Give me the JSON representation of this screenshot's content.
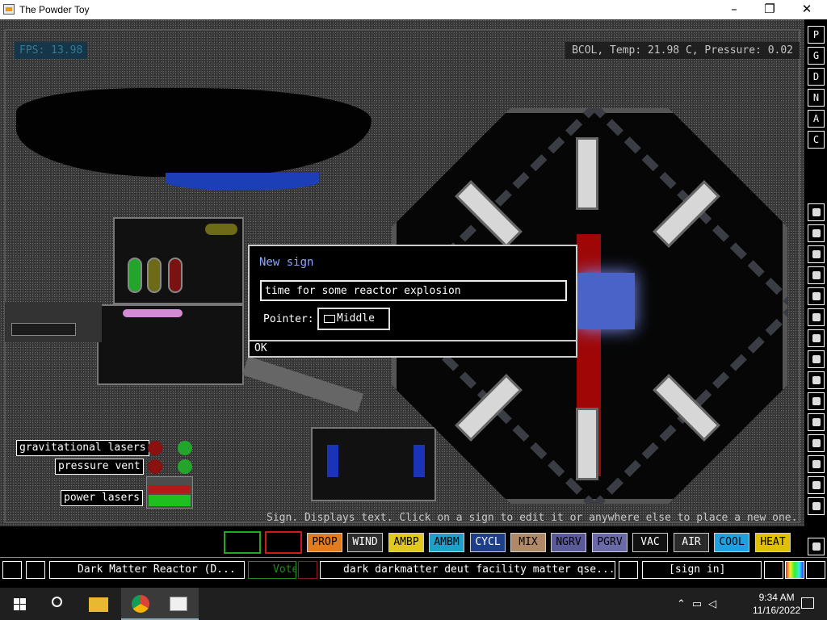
{
  "window": {
    "title": "The Powder Toy",
    "minimize": "–",
    "maximize": "❐",
    "close": "✕"
  },
  "hud": {
    "fps": "FPS: 13.98",
    "info": "BCOL, Temp: 21.98 C, Pressure: 0.02"
  },
  "sim_labels": {
    "label1": "gravitational lasers",
    "label2": "pressure vent",
    "label3": "power lasers"
  },
  "hint": "Sign. Displays text. Click on a sign to edit it or anywhere else to place a new one.",
  "dialog": {
    "title": "New sign",
    "text": "time for some reactor explosion",
    "pointer_label": "Pointer:",
    "pointer_value": "Middle",
    "ok": "OK"
  },
  "right_menu": [
    "P",
    "G",
    "D",
    "N",
    "A",
    "C"
  ],
  "elements": [
    {
      "label": "PROP",
      "bg": "#e07b1f",
      "fg": "#000"
    },
    {
      "label": "WIND",
      "bg": "#2c2c2c",
      "fg": "#fff"
    },
    {
      "label": "AMBP",
      "bg": "#e0c81f",
      "fg": "#000"
    },
    {
      "label": "AMBM",
      "bg": "#1fa0c8",
      "fg": "#000"
    },
    {
      "label": "CYCL",
      "bg": "#1e3e8a",
      "fg": "#fff"
    },
    {
      "label": "MIX",
      "bg": "#b08a68",
      "fg": "#000"
    },
    {
      "label": "NGRV",
      "bg": "#5a5a9a",
      "fg": "#000"
    },
    {
      "label": "PGRV",
      "bg": "#6a6aa8",
      "fg": "#000"
    },
    {
      "label": "VAC",
      "bg": "#111",
      "fg": "#fff"
    },
    {
      "label": "AIR",
      "bg": "#2a2a2a",
      "fg": "#fff"
    },
    {
      "label": "COOL",
      "bg": "#1fa0e0",
      "fg": "#000"
    },
    {
      "label": "HEAT",
      "bg": "#e0c000",
      "fg": "#000"
    }
  ],
  "bottombar": {
    "save_name": "Dark Matter Reactor (D...",
    "vote": "Vote",
    "tags": "dark darkmatter deut facility matter qse...",
    "login": "[sign in]"
  },
  "taskbar": {
    "time": "9:34 AM",
    "date": "11/16/2022"
  }
}
